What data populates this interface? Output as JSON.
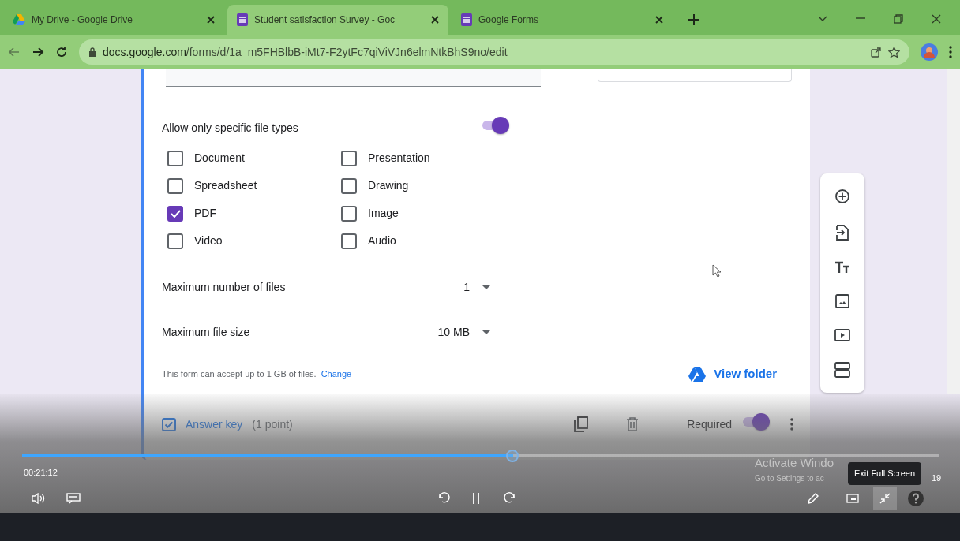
{
  "browser": {
    "tabs": [
      {
        "title": "My Drive - Google Drive",
        "kind": "drive",
        "selected": false
      },
      {
        "title": "Student satisfaction Survey - Goc",
        "kind": "forms",
        "selected": true
      },
      {
        "title": "Google Forms",
        "kind": "forms",
        "selected": false
      }
    ],
    "url_host": "docs.google.com",
    "url_path": "/forms/d/1a_m5FHBlbB-iMt7-F2ytFc7qiViVJn6elmNtkBhS9no/edit"
  },
  "form": {
    "allow_specific": {
      "label": "Allow only specific file types",
      "on": true
    },
    "file_types": [
      {
        "label": "Document",
        "checked": false
      },
      {
        "label": "Presentation",
        "checked": false
      },
      {
        "label": "Spreadsheet",
        "checked": false
      },
      {
        "label": "Drawing",
        "checked": false
      },
      {
        "label": "PDF",
        "checked": true
      },
      {
        "label": "Image",
        "checked": false
      },
      {
        "label": "Video",
        "checked": false
      },
      {
        "label": "Audio",
        "checked": false
      }
    ],
    "max_files": {
      "label": "Maximum number of files",
      "value": "1"
    },
    "max_size": {
      "label": "Maximum file size",
      "value": "10 MB"
    },
    "note": "This form can accept up to 1 GB of files.",
    "note_link": "Change",
    "view_folder": "View folder",
    "footer": {
      "answer_key": "Answer key",
      "points": "(1 point)",
      "required_label": "Required",
      "required": true
    }
  },
  "player": {
    "time": "00:21:12",
    "level": 0.535,
    "tooltip": "Exit Full Screen",
    "activate_title": "Activate Windo",
    "activate_sub": "Go to Settings to ac",
    "partial_text": "19"
  }
}
